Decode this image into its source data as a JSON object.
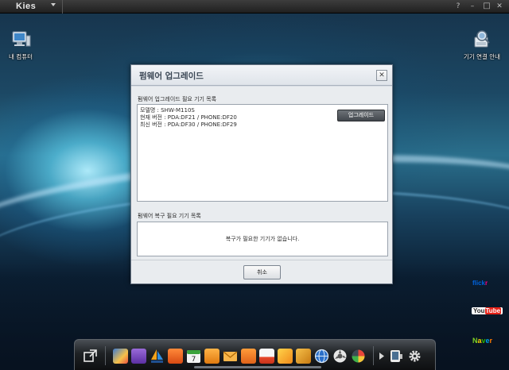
{
  "app": {
    "logo": "Kies",
    "controls": {
      "help": "?",
      "minimize": "–",
      "maximize": "□",
      "close": "✕"
    }
  },
  "desktop": {
    "icons": [
      {
        "label": "내 컴퓨터",
        "icon": "my-computer-icon"
      },
      {
        "label": "기기 연결 안내",
        "icon": "device-connection-guide-icon"
      }
    ]
  },
  "dialog": {
    "title": "펌웨어 업그레이드",
    "close": "✕",
    "upgrade_section": {
      "label": "펌웨어 업그레이드 필요 기기 목록",
      "lines": [
        "모델명 : SHW-M110S",
        "현재 버전 : PDA:DF21 / PHONE:DF20",
        "최신 버전 : PDA:DF30 / PHONE:DF29"
      ],
      "upgrade_button": "업그레이드"
    },
    "recovery_section": {
      "label": "펌웨어 복구 필요 기기 목록",
      "empty_message": "복구가 필요한 기기가 없습니다."
    },
    "cancel_button": "취소"
  },
  "brands": [
    {
      "name": "flickr",
      "icon": "flickr-logo-icon"
    },
    {
      "name": "YouTube",
      "icon": "youtube-logo-icon"
    },
    {
      "name": "Naver",
      "icon": "naver-logo-icon"
    }
  ],
  "dock": {
    "items": [
      "external-link-icon",
      "photo-album-icon",
      "media-bag-icon",
      "sailboat-icon",
      "phone-icon",
      "calendar-icon",
      "music-note-icon",
      "mail-icon",
      "memo-icon",
      "schedule-icon",
      "gallery-icon",
      "video-icon",
      "globe-icon",
      "recycle-icon",
      "palette-icon",
      "play-arrow-icon",
      "device-icon",
      "settings-gear-icon"
    ]
  },
  "colors": {
    "dialog_bg": "#d6dbe1",
    "button_dark": "#4a4f55",
    "desktop_accent": "#5fc8e6"
  }
}
